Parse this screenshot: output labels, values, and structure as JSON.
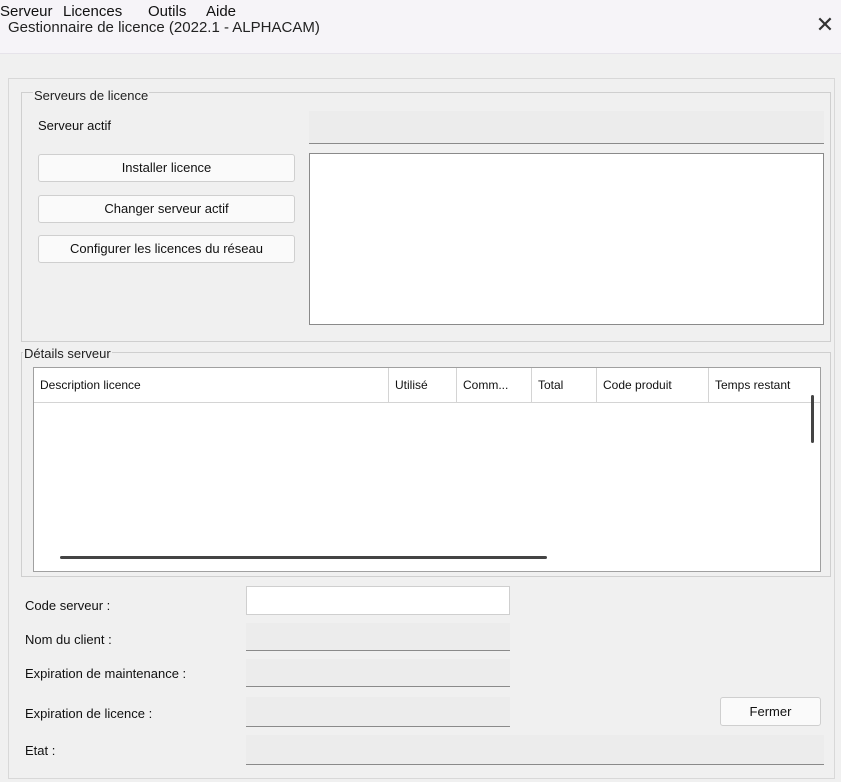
{
  "window": {
    "title": "Gestionnaire de licence (2022.1 - ALPHACAM)",
    "close": "✕"
  },
  "menu": [
    "Serveur",
    "Licences",
    "Outils",
    "Aide"
  ],
  "license_servers": {
    "group_label": "Serveurs de licence",
    "active_server_label": "Serveur actif",
    "active_server_value": "",
    "buttons": {
      "install": "Installer licence",
      "change": "Changer serveur actif",
      "configure": "Configurer les licences du réseau"
    }
  },
  "server_details": {
    "group_label": "Détails serveur",
    "columns": [
      "Description licence",
      "Utilisé",
      "Comm...",
      "Total",
      "Code produit",
      "Temps restant"
    ],
    "rows": []
  },
  "fields": {
    "server_code_label": "Code serveur :",
    "server_code_value": "",
    "client_name_label": "Nom du client :",
    "client_name_value": "",
    "maintenance_exp_label": "Expiration de maintenance :",
    "maintenance_exp_value": "",
    "license_exp_label": "Expiration de licence :",
    "license_exp_value": "",
    "state_label": "Etat :",
    "state_value": ""
  },
  "close_button": "Fermer"
}
